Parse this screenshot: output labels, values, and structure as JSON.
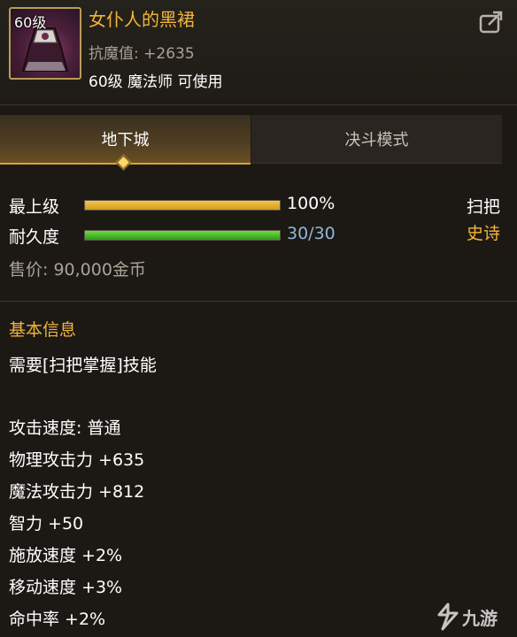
{
  "item": {
    "level_badge": "60级",
    "name": "女仆人的黑裙",
    "resist": "抗魔值: +2635",
    "requirement": "60级 魔法师 可使用"
  },
  "tabs": [
    {
      "label": "地下城",
      "active": true
    },
    {
      "label": "决斗模式",
      "active": false
    }
  ],
  "upgrade": {
    "label": "最上级",
    "value": "100%",
    "fill": 1.0
  },
  "durability": {
    "label": "耐久度",
    "value": "30/30",
    "fill": 1.0
  },
  "side": {
    "type": "扫把",
    "grade": "史诗"
  },
  "price": "售价: 90,000金币",
  "info": {
    "title": "基本信息",
    "lines": [
      "需要[扫把掌握]技能",
      "攻击速度: 普通",
      "物理攻击力 +635",
      "魔法攻击力 +812",
      "智力 +50",
      "施放速度 +2%",
      "移动速度 +3%",
      "命中率 +2%"
    ]
  },
  "colors": {
    "item_name": "#f2b53a",
    "grade": "#f2b53a",
    "durability_text": "#8fb6d6",
    "upgrade_bar": "#e6b02a",
    "durability_bar": "#4fc42e"
  },
  "watermark": "九游"
}
